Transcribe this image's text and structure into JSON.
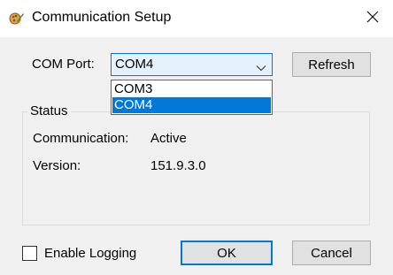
{
  "window": {
    "title": "Communication Setup",
    "close_glyph": "✕",
    "icon": "app-settings-icon"
  },
  "com_port": {
    "label": "COM Port:",
    "selected": "COM4",
    "options": [
      "COM3",
      "COM4"
    ],
    "highlighted_option": "COM4",
    "dropdown_open": true
  },
  "buttons": {
    "refresh": "Refresh",
    "ok": "OK",
    "cancel": "Cancel"
  },
  "status": {
    "group_title": "Status",
    "communication_label": "Communication:",
    "communication_value": "Active",
    "version_label": "Version:",
    "version_value": "151.9.3.0"
  },
  "logging": {
    "label": "Enable Logging",
    "checked": false
  },
  "colors": {
    "accent": "#0078d7",
    "background": "#f0f0f0",
    "button_face": "#e1e1e1"
  }
}
